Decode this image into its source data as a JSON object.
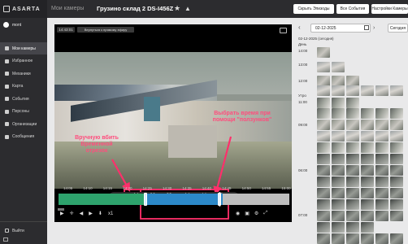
{
  "app": {
    "logo": "ASARTA",
    "user": "mont"
  },
  "sidebar": {
    "items": [
      {
        "label": "Мои камеры",
        "active": true,
        "icon": "camera-icon"
      },
      {
        "label": "Избранное",
        "icon": "star-icon"
      },
      {
        "label": "Механики",
        "icon": "people-icon"
      },
      {
        "label": "Карта",
        "icon": "map-icon"
      },
      {
        "label": "События",
        "icon": "bell-icon"
      },
      {
        "label": "Персоны",
        "icon": "person-icon"
      },
      {
        "label": "Организации",
        "icon": "building-icon"
      },
      {
        "label": "Сообщения",
        "icon": "message-icon"
      }
    ],
    "logout": "Выйти"
  },
  "header": {
    "breadcrumb": "Мои камеры",
    "title": "Грузино склад 2 DS-I456Z",
    "buttons": [
      "Скрыть Эпизоды",
      "Все События",
      "Настройки Камеры"
    ]
  },
  "player": {
    "overlay_time": "14:43:01",
    "overlay_badge": "Вернуться к прямому эфиру",
    "range": {
      "start_h": "14",
      "start_m": "26",
      "start_s": "33",
      "end_h": "14",
      "end_m": "44",
      "end_s": "33"
    },
    "timeline_ticks": [
      "14:05",
      "14:10",
      "14:15",
      "14:20",
      "14:25",
      "14:30",
      "14:35",
      "14:40",
      "14:45",
      "14:50",
      "14:55",
      "15:00"
    ],
    "speed": "x1"
  },
  "annotations": {
    "left": "Вручную вбить Временной отрезок",
    "right": "Выбрать время при помощи \"ползунков\""
  },
  "right_panel": {
    "date": "02-12-2025",
    "today_label": "Сегодня",
    "date_heading": "02-12-2025 (сегодня)",
    "section_day": "День",
    "time_labels": [
      "14:00",
      "13:00",
      "12:00",
      "Утро",
      "11:00",
      "09:00",
      "06:00",
      "07:00"
    ]
  },
  "colors": {
    "accent": "#2ea36d",
    "range": "#2c89c9",
    "annotation": "#ff2f6b",
    "sidebar": "#2c2c2f"
  }
}
